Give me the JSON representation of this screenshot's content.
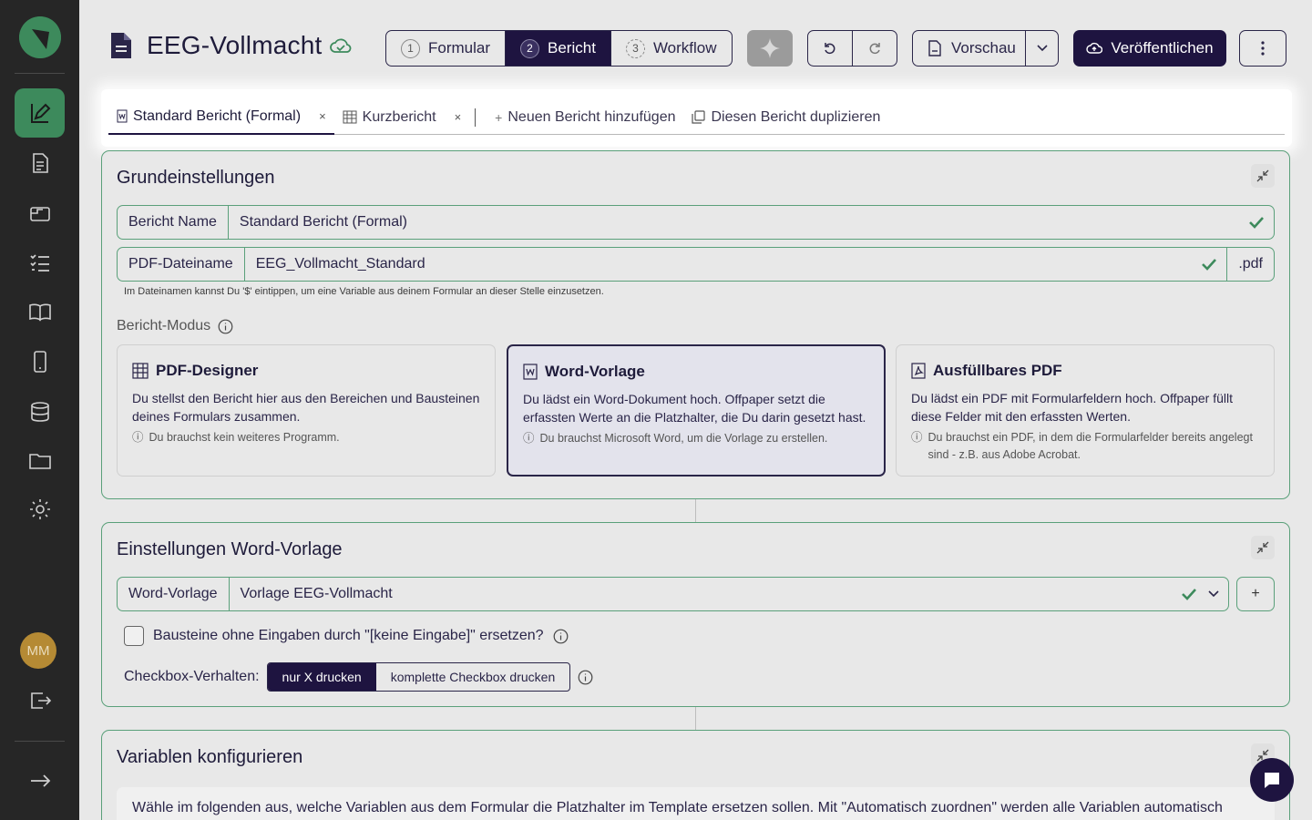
{
  "sidebar": {
    "avatar_initials": "MM",
    "items": [
      {
        "name": "editor",
        "icon": "edit-form-icon",
        "active": true
      },
      {
        "name": "reports",
        "icon": "report-icon"
      },
      {
        "name": "inbox",
        "icon": "inbox-icon"
      },
      {
        "name": "checklist",
        "icon": "checklist-icon"
      },
      {
        "name": "docs",
        "icon": "book-icon"
      },
      {
        "name": "mobile",
        "icon": "mobile-icon"
      },
      {
        "name": "database",
        "icon": "database-icon"
      },
      {
        "name": "folder",
        "icon": "folder-icon"
      },
      {
        "name": "settings",
        "icon": "gear-icon"
      }
    ]
  },
  "header": {
    "title": "EEG-Vollmacht",
    "steps": [
      {
        "num": "1",
        "label": "Formular"
      },
      {
        "num": "2",
        "label": "Bericht",
        "active": true
      },
      {
        "num": "3",
        "label": "Workflow"
      }
    ],
    "preview_label": "Vorschau",
    "publish_label": "Veröffentlichen"
  },
  "tabs": {
    "items": [
      {
        "label": "Standard Bericht (Formal)",
        "close": "×"
      },
      {
        "label": "Kurzbericht",
        "close": "×"
      }
    ],
    "add_label": "Neuen Bericht hinzufügen",
    "duplicate_label": "Diesen Bericht duplizieren"
  },
  "basic": {
    "title": "Grundeinstellungen",
    "name_label": "Bericht Name",
    "name_value": "Standard Bericht (Formal)",
    "pdf_label": "PDF-Dateiname",
    "pdf_value": "EEG_Vollmacht_Standard",
    "pdf_suffix": ".pdf",
    "hint": "Im Dateinamen kannst Du '$' eintippen, um eine Variable aus deinem Formular an dieser Stelle einzusetzen.",
    "mode_label": "Bericht-Modus",
    "modes": [
      {
        "title": "PDF-Designer",
        "desc": "Du stellst den Bericht hier aus den Bereichen und Bausteinen deines Formulars zusammen.",
        "note": "Du brauchst kein weiteres Programm."
      },
      {
        "title": "Word-Vorlage",
        "desc": "Du lädst ein Word-Dokument hoch. Offpaper setzt die erfassten Werte an die Platzhalter, die Du darin gesetzt hast.",
        "note": "Du brauchst Microsoft Word, um die Vorlage zu erstellen."
      },
      {
        "title": "Ausfüllbares PDF",
        "desc": "Du lädst ein PDF mit Formularfeldern hoch. Offpaper füllt diese Felder mit den erfassten Werten.",
        "note": "Du brauchst ein PDF, in dem die Formularfelder bereits angelegt sind - z.B. aus Adobe Acrobat."
      }
    ]
  },
  "word": {
    "title": "Einstellungen Word-Vorlage",
    "template_label": "Word-Vorlage",
    "template_value": "Vorlage EEG-Vollmacht",
    "plus": "+",
    "replace_label": "Bausteine ohne Eingaben durch \"[keine Eingabe]\" ersetzen?",
    "checkbox_behavior_label": "Checkbox-Verhalten:",
    "checkbox_options": [
      "nur X drucken",
      "komplette Checkbox drucken"
    ]
  },
  "variables": {
    "title": "Variablen konfigurieren",
    "text": "Wähle im folgenden aus, welche Variablen aus dem Formular die Platzhalter im Template ersetzen sollen. Mit \"Automatisch zuordnen\" werden alle Variablen automatisch"
  },
  "colors": {
    "accent": "#1e1440",
    "success": "#3d8a5c",
    "avatar": "#b58a34"
  }
}
